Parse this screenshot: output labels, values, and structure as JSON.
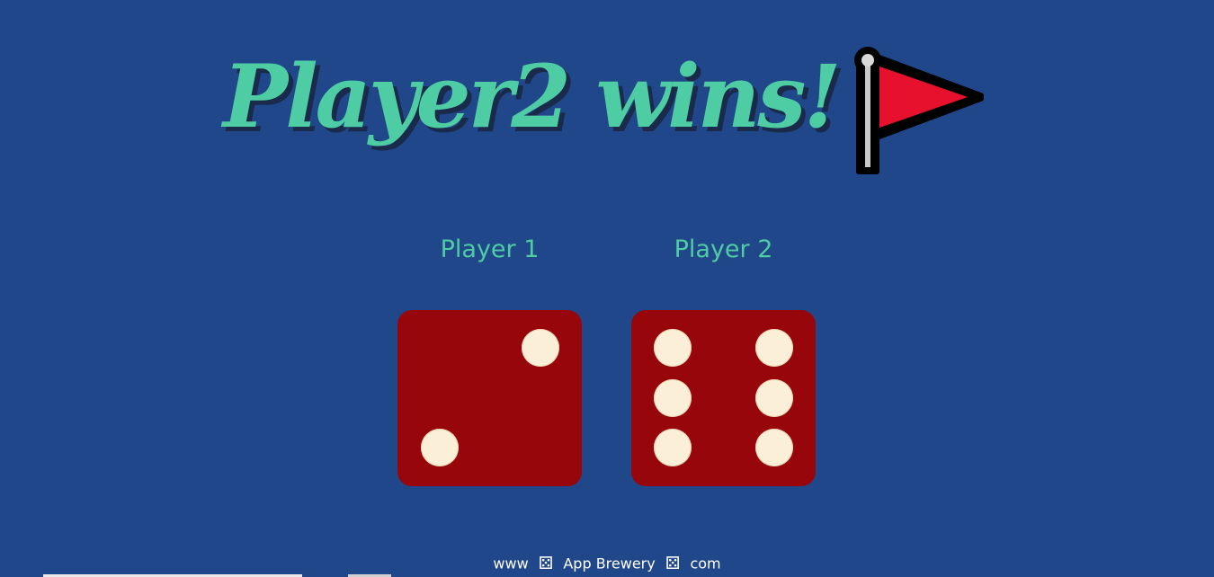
{
  "title": {
    "text": "Player2 wins!",
    "flag_icon": "red-flag-icon"
  },
  "players": [
    {
      "label": "Player 1",
      "die_value": 2
    },
    {
      "label": "Player 2",
      "die_value": 6
    }
  ],
  "footer": {
    "prefix": "www",
    "brand": "App Brewery",
    "suffix": "com",
    "icon": "dice-icon"
  },
  "colors": {
    "background": "#204789",
    "title": "#4ecca3",
    "die": "#97060b",
    "pip": "#fbefd8",
    "flag": "#e8112d"
  }
}
